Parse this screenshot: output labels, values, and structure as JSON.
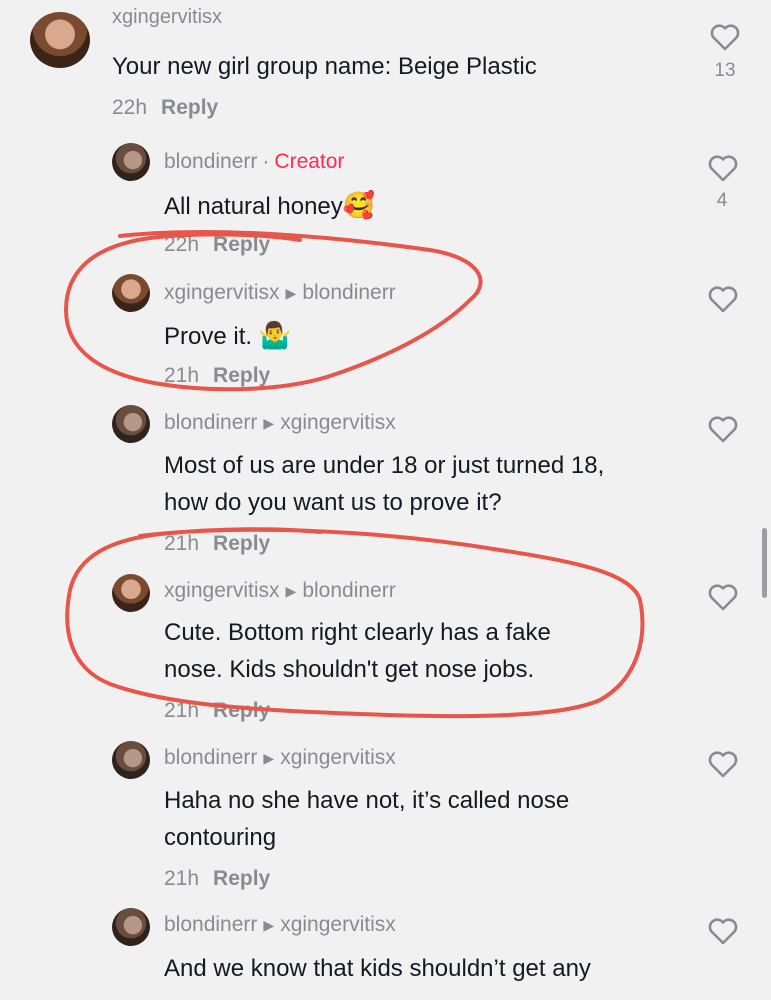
{
  "comments": [
    {
      "username": "xgingervitisx",
      "text": "Your new girl group name: Beige Plastic",
      "time": "22h",
      "reply": "Reply",
      "likes": "13"
    },
    {
      "username": "blondinerr",
      "badge_sep": "·",
      "badge": "Creator",
      "text": "All natural honey",
      "emoji": "🥰",
      "time": "22h",
      "reply": "Reply",
      "likes": "4"
    },
    {
      "username": "xgingervitisx",
      "reply_to": "blondinerr",
      "text": "Prove it.",
      "emoji": "🤷‍♂️",
      "time": "21h",
      "reply": "Reply"
    },
    {
      "username": "blondinerr",
      "reply_to": "xgingervitisx",
      "lines": [
        "Most of us are under 18 or just turned 18,",
        "how do you want us to prove it?"
      ],
      "time": "21h",
      "reply": "Reply"
    },
    {
      "username": "xgingervitisx",
      "reply_to": "blondinerr",
      "lines": [
        "Cute. Bottom right clearly has a fake",
        "nose. Kids shouldn't get nose jobs."
      ],
      "time": "21h",
      "reply": "Reply"
    },
    {
      "username": "blondinerr",
      "reply_to": "xgingervitisx",
      "lines": [
        "Haha no she have not, it’s called nose",
        "contouring"
      ],
      "time": "21h",
      "reply": "Reply"
    },
    {
      "username": "blondinerr",
      "reply_to": "xgingervitisx",
      "lines": [
        "And we know that kids shouldn’t get any"
      ]
    }
  ],
  "icons": {
    "heart": "heart-outline-icon",
    "reply_arrow": "triangle-right-icon"
  },
  "colors": {
    "background": "#f1f1f2",
    "text": "#161823",
    "muted": "#8a8b91",
    "creator": "#fe2c55",
    "annotation": "#e8554a"
  }
}
